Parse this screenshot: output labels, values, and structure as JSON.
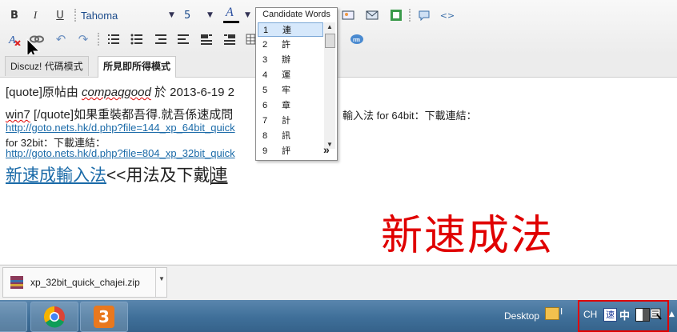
{
  "toolbar": {
    "font_name": "Tahoma",
    "font_size": "5",
    "bold_label": "B",
    "italic_label": "I",
    "underline_label": "U",
    "font_color_label": "A"
  },
  "tabs": [
    {
      "label": "Discuz! 代碼模式"
    },
    {
      "label": "所見即所得模式"
    }
  ],
  "editor": {
    "line1_prefix": "[quote]原帖由 ",
    "line1_user": "compaqgood",
    "line1_suffix": " 於 2013-6-19 2",
    "line2_a": "win7",
    "line2_b": " [/quote]如果重裝都吾得.就吾係速成問",
    "line2_c": "輸入法 for 64bit：下載連結：",
    "link1": "http://goto.nets.hk/d.php?file=144_xp_64bit_quick",
    "line4": "for 32bit：下載連結：",
    "link2": "http://goto.nets.hk/d.php?file=804_xp_32bit_quick",
    "line6_link": "新速成輸入法",
    "line6_text": "<<用法及下戴",
    "line6_composing": "連",
    "overlay_text": "新速成法"
  },
  "candidate_window": {
    "title": "Candidate Words",
    "items": [
      {
        "num": "1",
        "char": "連"
      },
      {
        "num": "2",
        "char": "許"
      },
      {
        "num": "3",
        "char": "辦"
      },
      {
        "num": "4",
        "char": "運"
      },
      {
        "num": "5",
        "char": "牢"
      },
      {
        "num": "6",
        "char": "章"
      },
      {
        "num": "7",
        "char": "計"
      },
      {
        "num": "8",
        "char": "訊"
      },
      {
        "num": "9",
        "char": "評"
      }
    ],
    "more": "»"
  },
  "download": {
    "filename": "xp_32bit_quick_chajei.zip"
  },
  "taskbar": {
    "desktop_label": "Desktop",
    "lang_label": "CH",
    "ime_speed": "速",
    "ime_mode": "中"
  },
  "colors": {
    "overlay": "#e00000",
    "link": "#1a6aa8",
    "taskbar": "#4677a3"
  }
}
